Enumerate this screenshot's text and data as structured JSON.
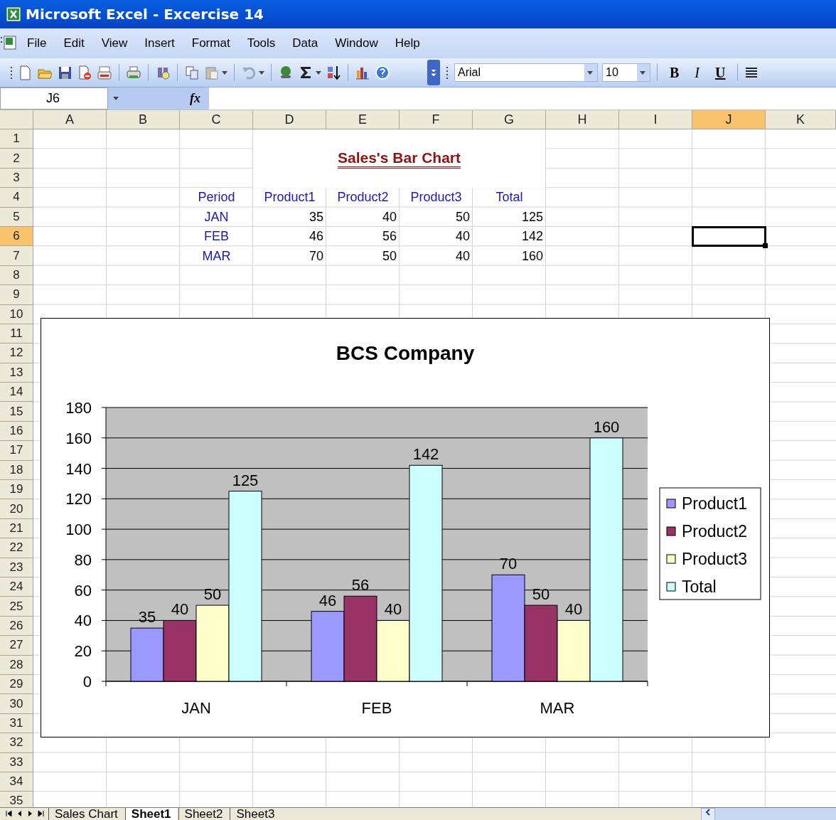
{
  "window": {
    "title": "Microsoft Excel - Excercise 14"
  },
  "menu": [
    "File",
    "Edit",
    "View",
    "Insert",
    "Format",
    "Tools",
    "Data",
    "Window",
    "Help"
  ],
  "toolbar": {
    "font": "Arial",
    "size": "10",
    "bold": "B",
    "italic": "I",
    "underline": "U"
  },
  "formula_bar": {
    "name_box": "J6",
    "function_label": "fx"
  },
  "columns": [
    {
      "label": "A",
      "selected": false
    },
    {
      "label": "B",
      "selected": false
    },
    {
      "label": "C",
      "selected": false
    },
    {
      "label": "D",
      "selected": false
    },
    {
      "label": "E",
      "selected": false
    },
    {
      "label": "F",
      "selected": false
    },
    {
      "label": "G",
      "selected": false
    },
    {
      "label": "H",
      "selected": false
    },
    {
      "label": "I",
      "selected": false
    },
    {
      "label": "J",
      "selected": true
    },
    {
      "label": "K",
      "selected": false
    }
  ],
  "rows": [
    {
      "label": "1",
      "selected": false
    },
    {
      "label": "2",
      "selected": false
    },
    {
      "label": "3",
      "selected": false
    },
    {
      "label": "4",
      "selected": false
    },
    {
      "label": "5",
      "selected": false
    },
    {
      "label": "6",
      "selected": true
    },
    {
      "label": "7",
      "selected": false
    },
    {
      "label": "8",
      "selected": false
    },
    {
      "label": "9",
      "selected": false
    },
    {
      "label": "10",
      "selected": false
    },
    {
      "label": "11",
      "selected": false
    },
    {
      "label": "12",
      "selected": false
    },
    {
      "label": "13",
      "selected": false
    },
    {
      "label": "14",
      "selected": false
    },
    {
      "label": "15",
      "selected": false
    },
    {
      "label": "16",
      "selected": false
    },
    {
      "label": "17",
      "selected": false
    },
    {
      "label": "18",
      "selected": false
    },
    {
      "label": "19",
      "selected": false
    },
    {
      "label": "20",
      "selected": false
    },
    {
      "label": "21",
      "selected": false
    },
    {
      "label": "22",
      "selected": false
    },
    {
      "label": "23",
      "selected": false
    },
    {
      "label": "24",
      "selected": false
    },
    {
      "label": "25",
      "selected": false
    },
    {
      "label": "26",
      "selected": false
    },
    {
      "label": "27",
      "selected": false
    },
    {
      "label": "28",
      "selected": false
    },
    {
      "label": "29",
      "selected": false
    },
    {
      "label": "30",
      "selected": false
    },
    {
      "label": "31",
      "selected": false
    },
    {
      "label": "32",
      "selected": false
    },
    {
      "label": "33",
      "selected": false
    },
    {
      "label": "34",
      "selected": false
    },
    {
      "label": "35",
      "selected": false
    }
  ],
  "sheet": {
    "title": "Sales's Bar Chart",
    "headers": [
      "Period",
      "Product1",
      "Product2",
      "Product3",
      "Total"
    ],
    "data": [
      [
        "JAN",
        "35",
        "40",
        "50",
        "125"
      ],
      [
        "FEB",
        "46",
        "56",
        "40",
        "142"
      ],
      [
        "MAR",
        "70",
        "50",
        "40",
        "160"
      ]
    ]
  },
  "chart": {
    "chart_data": {
      "type": "bar",
      "title": "BCS Company",
      "categories": [
        "JAN",
        "FEB",
        "MAR"
      ],
      "series": [
        {
          "name": "Product1",
          "color": "#9999ff",
          "values": [
            35,
            46,
            70
          ]
        },
        {
          "name": "Product2",
          "color": "#993366",
          "values": [
            40,
            56,
            50
          ]
        },
        {
          "name": "Product3",
          "color": "#ffffcc",
          "values": [
            50,
            40,
            40
          ]
        },
        {
          "name": "Total",
          "color": "#ccffff",
          "values": [
            125,
            142,
            160
          ]
        }
      ],
      "grid": true,
      "legend": "right",
      "ylim": [
        0,
        180
      ],
      "yticks": [
        0,
        20,
        40,
        60,
        80,
        100,
        120,
        140,
        160,
        180
      ],
      "data_labels": true
    }
  },
  "sheet_tabs": [
    {
      "label": "Sales Chart",
      "selected": false
    },
    {
      "label": "Sheet1",
      "selected": true
    },
    {
      "label": "Sheet2",
      "selected": false
    },
    {
      "label": "Sheet3",
      "selected": false
    }
  ]
}
